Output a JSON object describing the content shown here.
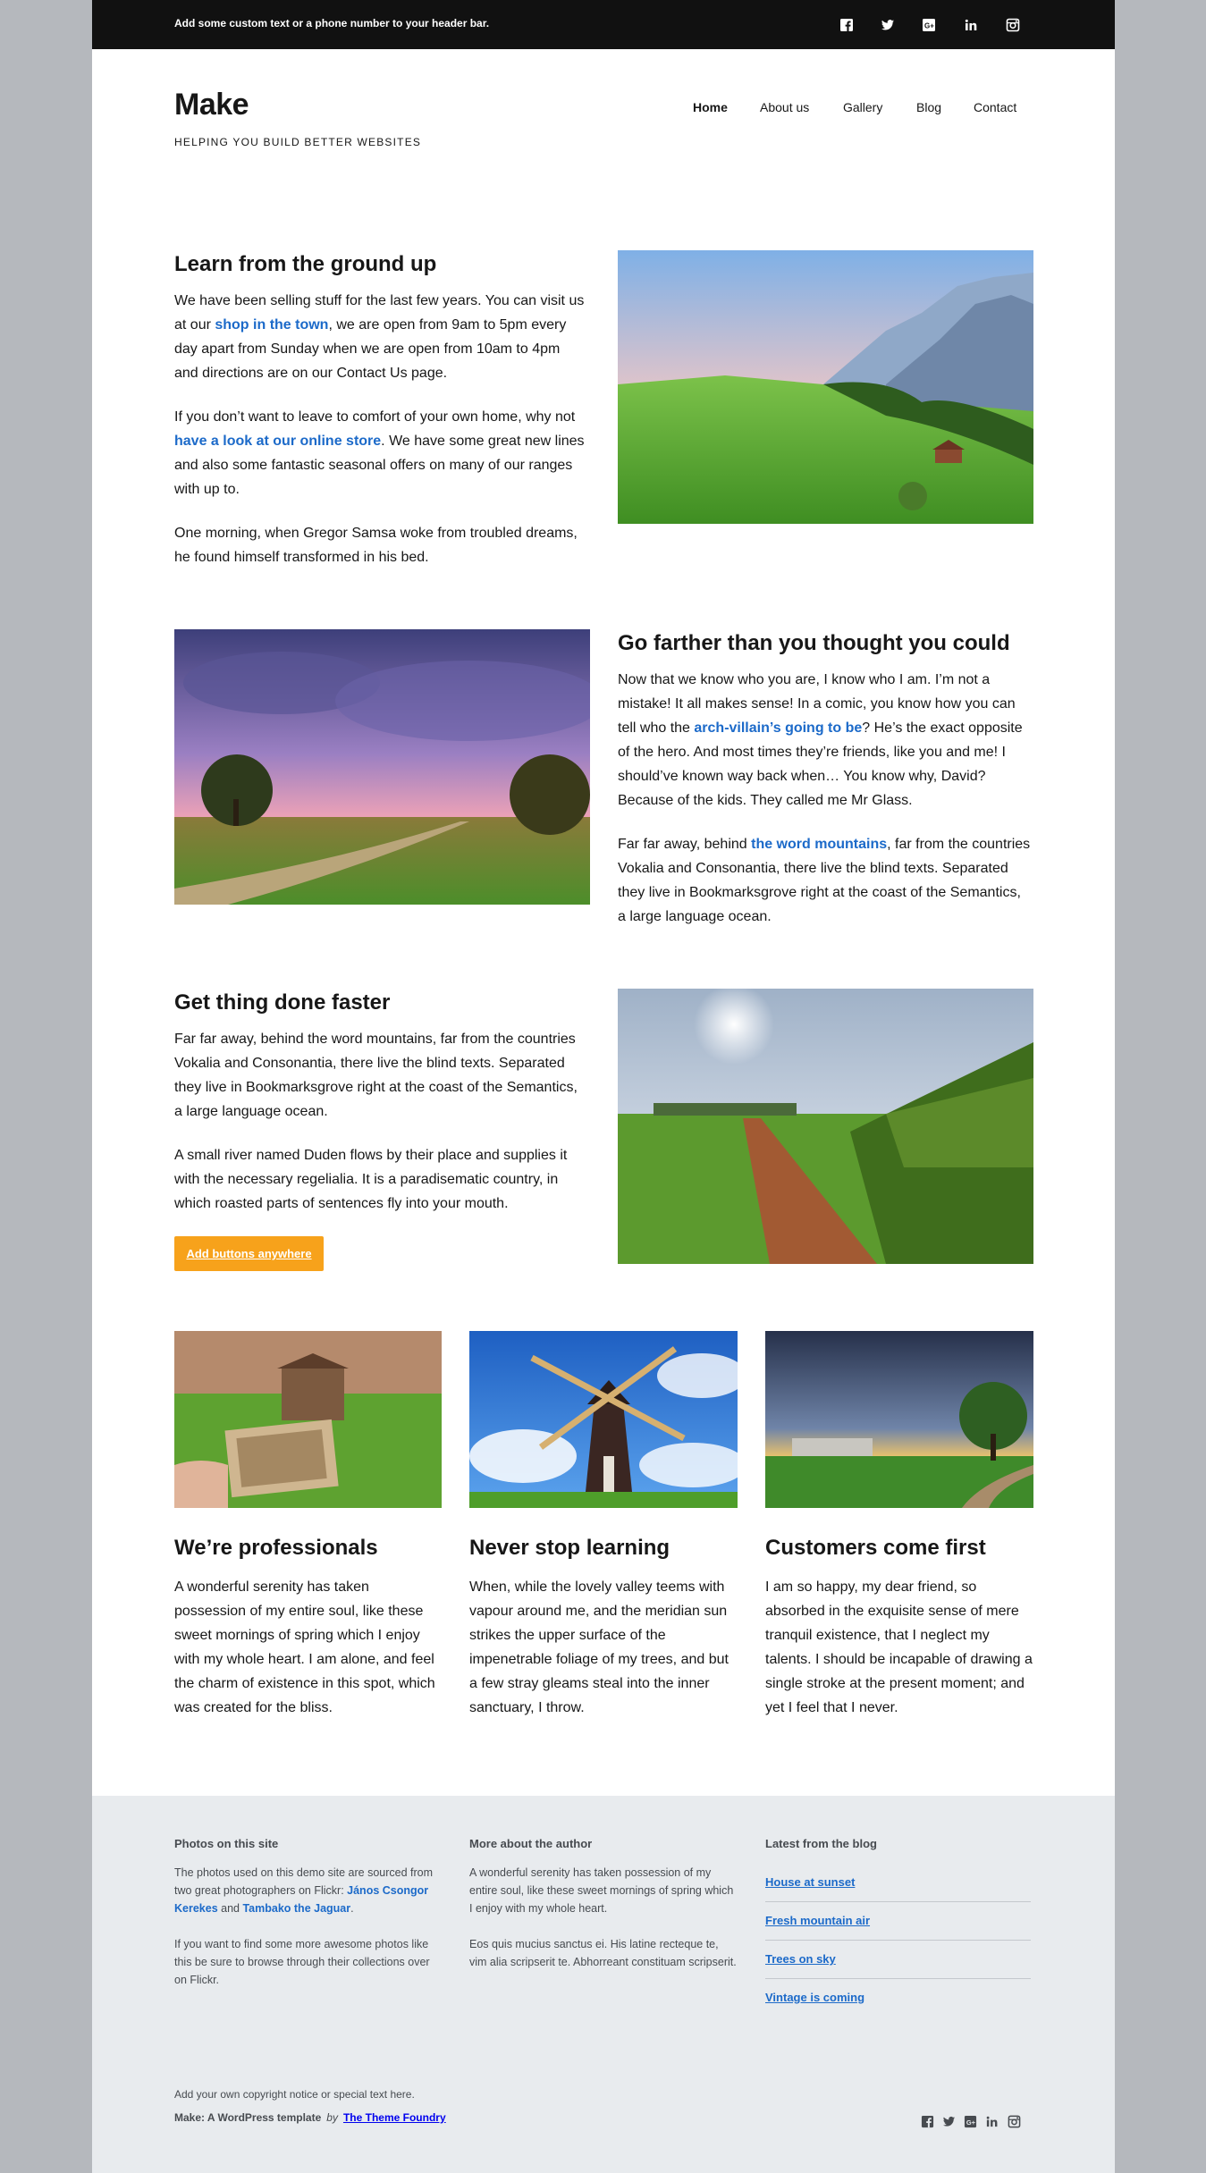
{
  "header": {
    "bar_text": "Add some custom text or a phone number to your header bar.",
    "social_icons": [
      "facebook-icon",
      "twitter-icon",
      "google-plus-icon",
      "linkedin-icon",
      "instagram-icon"
    ]
  },
  "site": {
    "title": "Make",
    "tagline": "HELPING YOU BUILD BETTER WEBSITES"
  },
  "nav": {
    "items": [
      "Home",
      "About us",
      "Gallery",
      "Blog",
      "Contact"
    ],
    "active": "Home"
  },
  "section1": {
    "heading": "Learn from the ground up",
    "p1_a": "We have been selling stuff for the last few years. You can visit us at our ",
    "p1_link": "shop in the town",
    "p1_b": ", we are open from 9am to 5pm every day apart from Sunday when we are open from 10am to 4pm and directions are on our Contact Us page.",
    "p2_a": "If you don’t want to leave to comfort of your own home, why not ",
    "p2_link": "have a look at our online store",
    "p2_b": ". We have some great new lines and also some fantastic seasonal offers on many of our ranges with up to.",
    "p3": "One morning, when Gregor Samsa woke from troubled dreams, he found himself transformed in his bed."
  },
  "section2": {
    "heading": "Go farther than you thought you could",
    "p1_a": "Now that we know who you are, I know who I am. I’m not a mistake! It all makes sense! In a comic, you know how you can tell who the ",
    "p1_link": "arch-villain’s going to be",
    "p1_b": "? He’s the exact opposite of the hero. And most times they’re friends, like you and me! I should’ve known way back when… You know why, David? Because of the kids. They called me Mr Glass.",
    "p2_a": "Far far away, behind ",
    "p2_link": "the word mountains",
    "p2_b": ", far from the countries Vokalia and Consonantia, there live the blind texts. Separated they live in Bookmarksgrove right at the coast of the Semantics, a large language ocean."
  },
  "section3": {
    "heading": "Get thing done faster",
    "p1": "Far far away, behind the word mountains, far from the countries Vokalia and Consonantia, there live the blind texts. Separated they live in Bookmarksgrove right at the coast of the Semantics, a large language ocean.",
    "p2": "A small river named Duden flows by their place and supplies it with the necessary regelialia. It is a paradisematic country, in which roasted parts of sentences fly into your mouth.",
    "button": "Add buttons anywhere"
  },
  "columns": [
    {
      "heading": "We’re professionals",
      "text": "A wonderful serenity has taken possession of my entire soul, like these sweet mornings of spring which I enjoy with my whole heart. I am alone, and feel the charm of existence in this spot, which was created for the bliss."
    },
    {
      "heading": "Never stop learning",
      "text": "When, while the lovely valley teems with vapour around me, and the meridian sun strikes the upper surface of the impenetrable foliage of my trees, and but a few stray gleams steal into the inner sanctuary, I throw."
    },
    {
      "heading": "Customers come first",
      "text": "I am so happy, my dear friend, so absorbed in the exquisite sense of mere tranquil existence, that I neglect my talents. I should be incapable of drawing a single stroke at the present moment; and yet I feel that I never."
    }
  ],
  "footer": {
    "col1": {
      "heading": "Photos on this site",
      "p1_a": "The photos used on this demo site are sourced from two great photographers on Flickr: ",
      "p1_link1": "János Csongor Kerekes",
      "p1_and": " and ",
      "p1_link2": "Tambako the Jaguar",
      "p1_end": ".",
      "p2": "If you want to find some more awesome photos like this be sure to browse through their collections over on Flickr."
    },
    "col2": {
      "heading": "More about the author",
      "p1": "A wonderful serenity has taken possession of my entire soul, like these sweet mornings of spring which I enjoy with my whole heart.",
      "p2": "Eos quis mucius sanctus ei. His latine recteque te, vim alia scripserit te. Abhorreant constituam scripserit."
    },
    "col3": {
      "heading": "Latest from the blog",
      "posts": [
        "House at sunset",
        "Fresh mountain air",
        "Trees on sky",
        "Vintage is coming"
      ]
    },
    "copyright": "Add your own copyright notice or special text here.",
    "credit": "Make: A WordPress template",
    "credit_by": "by",
    "credit_link": "The Theme Foundry"
  },
  "colors": {
    "link": "#1c6ac9",
    "button": "#f7a21b",
    "header_bar": "#111111",
    "footer_bg": "#e8ebee",
    "outer_bg": "#b5b8bd"
  }
}
